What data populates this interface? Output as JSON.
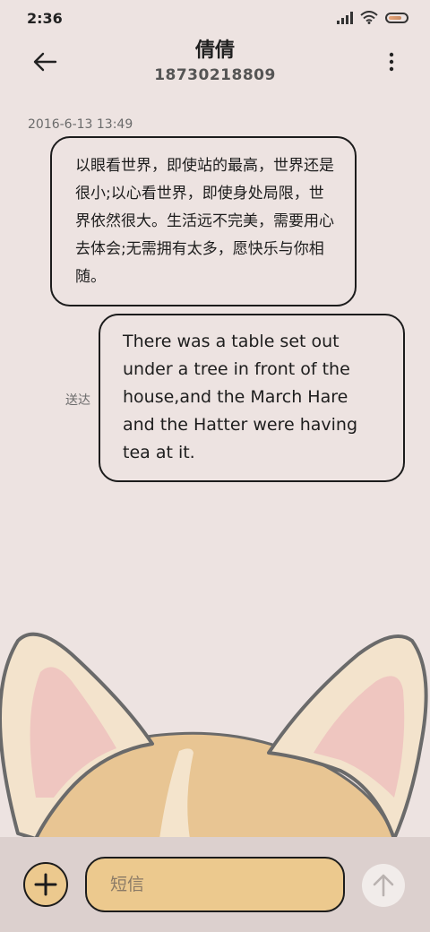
{
  "status_bar": {
    "time": "2:36"
  },
  "header": {
    "contact_name": "倩倩",
    "phone_number": "18730218809"
  },
  "conversation": {
    "timestamp": "2016-6-13 13:49",
    "messages": [
      {
        "direction": "incoming",
        "text": "以眼看世界，即使站的最高，世界还是很小;以心看世界，即使身处局限，世界依然很大。生活远不完美，需要用心去体会;无需拥有太多，愿快乐与你相随。"
      },
      {
        "direction": "outgoing",
        "text": "There was a table set out under a tree in front of the house,and the March Hare and the Hatter were having tea at it.",
        "status": "送达"
      }
    ]
  },
  "composer": {
    "placeholder": "短信"
  },
  "icons": {
    "back": "back-arrow-icon",
    "more": "more-vertical-icon",
    "add": "plus-icon",
    "send": "arrow-up-icon",
    "signal": "signal-icon",
    "wifi": "wifi-icon",
    "battery": "battery-icon"
  },
  "colors": {
    "background": "#ede3e1",
    "input_fill": "#ecc98e",
    "bubble_border": "#1c1c1c"
  }
}
